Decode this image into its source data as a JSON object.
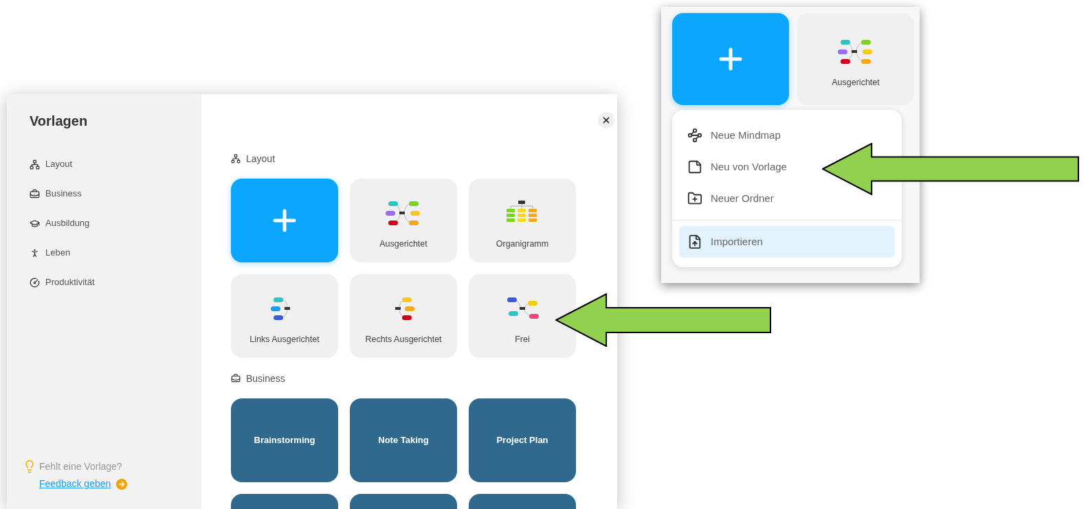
{
  "dialog": {
    "title": "Vorlagen",
    "sidebar": [
      {
        "label": "Layout"
      },
      {
        "label": "Business"
      },
      {
        "label": "Ausbildung"
      },
      {
        "label": "Leben"
      },
      {
        "label": "Produktivität"
      }
    ],
    "hint": "Fehlt eine Vorlage?",
    "link": "Feedback geben",
    "sections": [
      {
        "title": "Layout",
        "cards": [
          {
            "kind": "new"
          },
          {
            "kind": "aligned",
            "label": "Ausgerichtet"
          },
          {
            "kind": "org",
            "label": "Organigramm"
          },
          {
            "kind": "left",
            "label": "Links Ausgerichtet"
          },
          {
            "kind": "right",
            "label": "Rechts Ausgerichtet"
          },
          {
            "kind": "free",
            "label": "Frei"
          }
        ]
      },
      {
        "title": "Business",
        "cards": [
          {
            "kind": "photo",
            "label": "Brainstorming"
          },
          {
            "kind": "photo",
            "label": "Note Taking"
          },
          {
            "kind": "photo",
            "label": "Project Plan"
          },
          {
            "kind": "photo"
          },
          {
            "kind": "photo"
          },
          {
            "kind": "photo"
          }
        ]
      }
    ]
  },
  "inset": {
    "cards": [
      {
        "kind": "new"
      },
      {
        "kind": "aligned",
        "label": "Ausgerichtet"
      }
    ],
    "menu": [
      {
        "label": "Neue Mindmap",
        "selected": false
      },
      {
        "label": "Neu von Vorlage",
        "selected": false
      },
      {
        "label": "Neuer Ordner",
        "selected": false
      },
      {
        "label": "Importieren",
        "selected": true
      }
    ]
  }
}
